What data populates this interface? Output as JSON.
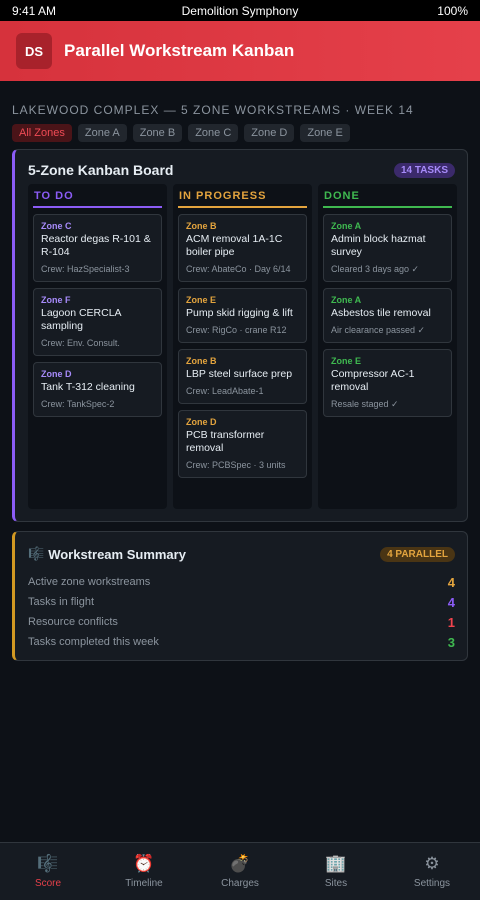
{
  "status": {
    "time": "9:41 AM",
    "carrier": "Demolition Symphony",
    "battery": "100%"
  },
  "header": {
    "avatar": "DS",
    "title": "Parallel Workstream Kanban"
  },
  "project_line": "Lakewood Complex — 5 Zone Workstreams · Week 14",
  "zone_filters": [
    "All Zones",
    "Zone A",
    "Zone B",
    "Zone C",
    "Zone D",
    "Zone E"
  ],
  "board": {
    "title": "5-Zone Kanban Board",
    "badge": "14 TASKS",
    "columns": [
      {
        "label": "TO DO",
        "color": "#8b5cf6",
        "tasks": [
          {
            "zone": "Zone C",
            "zone_color": "#a78bfa",
            "name": "Reactor degas R-101 & R-104",
            "meta": "Crew: HazSpecialist-3"
          },
          {
            "zone": "Zone F",
            "zone_color": "#a78bfa",
            "name": "Lagoon CERCLA sampling",
            "meta": "Crew: Env. Consult."
          },
          {
            "zone": "Zone D",
            "zone_color": "#a78bfa",
            "name": "Tank T-312 cleaning",
            "meta": "Crew: TankSpec-2"
          }
        ]
      },
      {
        "label": "IN PROGRESS",
        "color": "#e3a43e",
        "tasks": [
          {
            "zone": "Zone B",
            "zone_color": "#e3a43e",
            "name": "ACM removal 1A-1C boiler pipe",
            "meta": "Crew: AbateCo · Day 6/14"
          },
          {
            "zone": "Zone E",
            "zone_color": "#e3a43e",
            "name": "Pump skid rigging & lift",
            "meta": "Crew: RigCo · crane R12"
          },
          {
            "zone": "Zone B",
            "zone_color": "#e3a43e",
            "name": "LBP steel surface prep",
            "meta": "Crew: LeadAbate-1"
          },
          {
            "zone": "Zone D",
            "zone_color": "#e3a43e",
            "name": "PCB transformer removal",
            "meta": "Crew: PCBSpec · 3 units"
          }
        ]
      },
      {
        "label": "DONE",
        "color": "#3fb950",
        "tasks": [
          {
            "zone": "Zone A",
            "zone_color": "#3fb950",
            "name": "Admin block hazmat survey",
            "meta": "Cleared 3 days ago ✓"
          },
          {
            "zone": "Zone A",
            "zone_color": "#3fb950",
            "name": "Asbestos tile removal",
            "meta": "Air clearance passed ✓"
          },
          {
            "zone": "Zone E",
            "zone_color": "#3fb950",
            "name": "Compressor AC-1 removal",
            "meta": "Resale staged ✓"
          }
        ]
      }
    ]
  },
  "summary": {
    "icon": "🎼",
    "title": "Workstream Summary",
    "badge": "4 PARALLEL",
    "stats": [
      {
        "label": "Active zone workstreams",
        "value": "4",
        "color": "#e3a43e"
      },
      {
        "label": "Tasks in flight",
        "value": "4",
        "color": "#8b5cf6"
      },
      {
        "label": "Resource conflicts",
        "value": "1",
        "color": "#f0444e"
      },
      {
        "label": "Tasks completed this week",
        "value": "3",
        "color": "#3fb950"
      }
    ]
  },
  "tabs": [
    {
      "icon": "🎼",
      "icon_name": "score-icon",
      "label": "Score"
    },
    {
      "icon": "⏰",
      "icon_name": "alarm-clock-icon",
      "label": "Timeline"
    },
    {
      "icon": "💣",
      "icon_name": "bomb-icon",
      "label": "Charges"
    },
    {
      "icon": "🏢",
      "icon_name": "building-icon",
      "label": "Sites"
    },
    {
      "icon": "⚙",
      "icon_name": "gear-icon",
      "label": "Settings"
    }
  ],
  "colors": {
    "accent": "#e5404a",
    "purple": "#8b5cf6",
    "amber": "#e3a43e",
    "green": "#3fb950"
  }
}
